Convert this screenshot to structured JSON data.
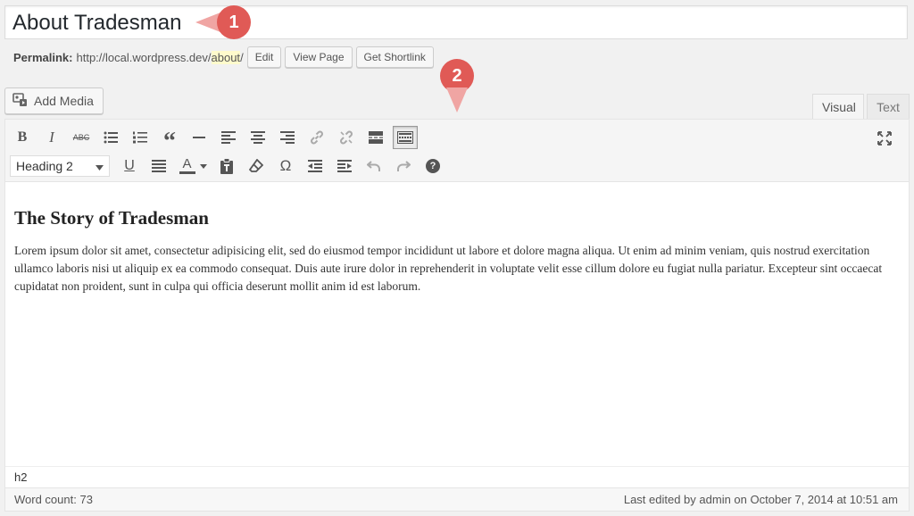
{
  "title": {
    "value": "About Tradesman"
  },
  "callouts": [
    "1",
    "2"
  ],
  "permalink": {
    "label": "Permalink:",
    "base": "http://local.wordpress.dev/",
    "slug": "about",
    "trail": "/",
    "edit": "Edit",
    "view": "View Page",
    "shortlink": "Get Shortlink"
  },
  "media": {
    "label": "Add Media"
  },
  "tabs": {
    "visual": "Visual",
    "text": "Text"
  },
  "toolbar": {
    "format": "Heading 2",
    "icons": {
      "bold": "B",
      "italic": "I",
      "strike": "ABC",
      "blockquote": "“",
      "underline": "U",
      "color": "A",
      "omega": "Ω",
      "help": "?"
    }
  },
  "content": {
    "heading": "The Story of Tradesman",
    "paragraph": "Lorem ipsum dolor sit amet, consectetur adipisicing elit, sed do eiusmod tempor incididunt ut labore et dolore magna aliqua. Ut enim ad minim veniam, quis nostrud exercitation ullamco laboris nisi ut aliquip ex ea commodo consequat. Duis aute irure dolor in reprehenderit in voluptate velit esse cillum dolore eu fugiat nulla pariatur. Excepteur sint occaecat cupidatat non proident, sunt in culpa qui officia deserunt mollit anim id est laborum."
  },
  "path": "h2",
  "status": {
    "word_count": "Word count: 73",
    "last_edited": "Last edited by admin on October 7, 2014 at 10:51 am"
  }
}
